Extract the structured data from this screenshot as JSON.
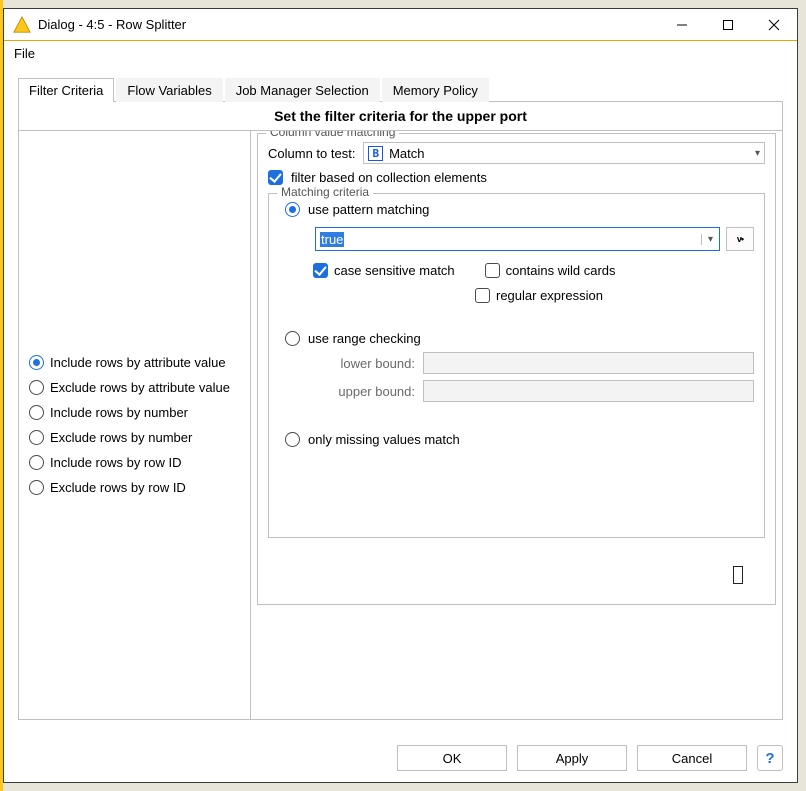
{
  "window": {
    "title": "Dialog - 4:5 - Row Splitter"
  },
  "menubar": {
    "file": "File"
  },
  "tabs": {
    "filter_criteria": "Filter Criteria",
    "flow_variables": "Flow Variables",
    "job_manager": "Job Manager Selection",
    "memory_policy": "Memory Policy"
  },
  "panel": {
    "header": "Set the filter criteria for the upper port"
  },
  "modes": {
    "include_attr": "Include rows by attribute value",
    "exclude_attr": "Exclude rows by attribute value",
    "include_num": "Include rows by number",
    "exclude_num": "Exclude rows by number",
    "include_rowid": "Include rows by row ID",
    "exclude_rowid": "Exclude rows by row ID"
  },
  "col_match": {
    "group_title": "Column value matching",
    "col_to_test_label": "Column to test:",
    "col_badge": "B",
    "col_selected": "Match",
    "filter_collection": "filter based on collection elements"
  },
  "matching": {
    "group_title": "Matching criteria",
    "use_pattern": "use pattern matching",
    "pattern_value": "true",
    "case_sensitive": "case sensitive match",
    "wildcards": "contains wild cards",
    "regex": "regular expression",
    "use_range": "use range checking",
    "lower_label": "lower bound:",
    "upper_label": "upper bound:",
    "only_missing": "only missing values match"
  },
  "footer": {
    "ok": "OK",
    "apply": "Apply",
    "cancel": "Cancel",
    "help": "?"
  }
}
